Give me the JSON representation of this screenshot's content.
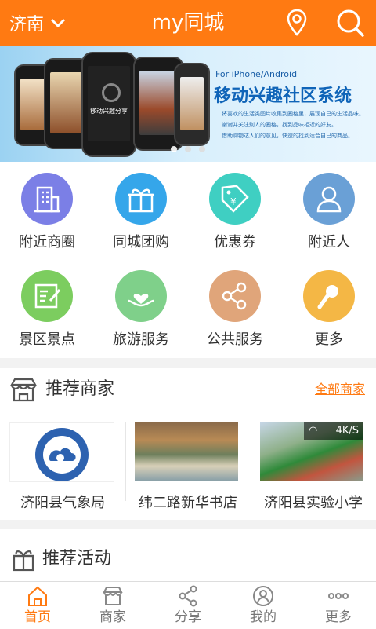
{
  "header": {
    "city": "济南",
    "title": "my同城"
  },
  "banner": {
    "subtitle": "For iPhone/Android",
    "title": "移动兴趣社区系统",
    "bullets": [
      "将喜欢的生活类图片收集到圈格里，展现自己的生活品味。",
      "谢谢并关注别人的圈格，找到品味相近的好友。",
      "借助购物达人们的意见，快速的找到适合自己的商品。"
    ],
    "phone_text": "移动兴趣分享"
  },
  "grid": [
    {
      "label": "附近商圈",
      "color": "#7b7fe6",
      "icon": "building-icon"
    },
    {
      "label": "同城团购",
      "color": "#35a6ea",
      "icon": "gift-icon"
    },
    {
      "label": "优惠券",
      "color": "#3fcfc2",
      "icon": "coupon-tag-icon"
    },
    {
      "label": "附近人",
      "color": "#6aa0d6",
      "icon": "person-icon"
    },
    {
      "label": "景区景点",
      "color": "#7ccd5f",
      "icon": "note-edit-icon"
    },
    {
      "label": "旅游服务",
      "color": "#7fd08a",
      "icon": "heart-hand-icon"
    },
    {
      "label": "公共服务",
      "color": "#e0a57a",
      "icon": "share-icon"
    },
    {
      "label": "更多",
      "color": "#f4b745",
      "icon": "microphone-icon"
    }
  ],
  "merchants": {
    "title": "推荐商家",
    "more": "全部商家",
    "items": [
      {
        "name": "济阳县气象局"
      },
      {
        "name": "纬二路新华书店"
      },
      {
        "name": "济阳县实验小学"
      }
    ],
    "speed_badge": "4K/S"
  },
  "activities": {
    "title": "推荐活动"
  },
  "tabbar": [
    {
      "label": "首页",
      "icon": "home-icon",
      "active": true
    },
    {
      "label": "商家",
      "icon": "shop-icon",
      "active": false
    },
    {
      "label": "分享",
      "icon": "share-icon",
      "active": false
    },
    {
      "label": "我的",
      "icon": "user-icon",
      "active": false
    },
    {
      "label": "更多",
      "icon": "more-dots-icon",
      "active": false
    }
  ],
  "colors": {
    "accent": "#ff7a12"
  }
}
